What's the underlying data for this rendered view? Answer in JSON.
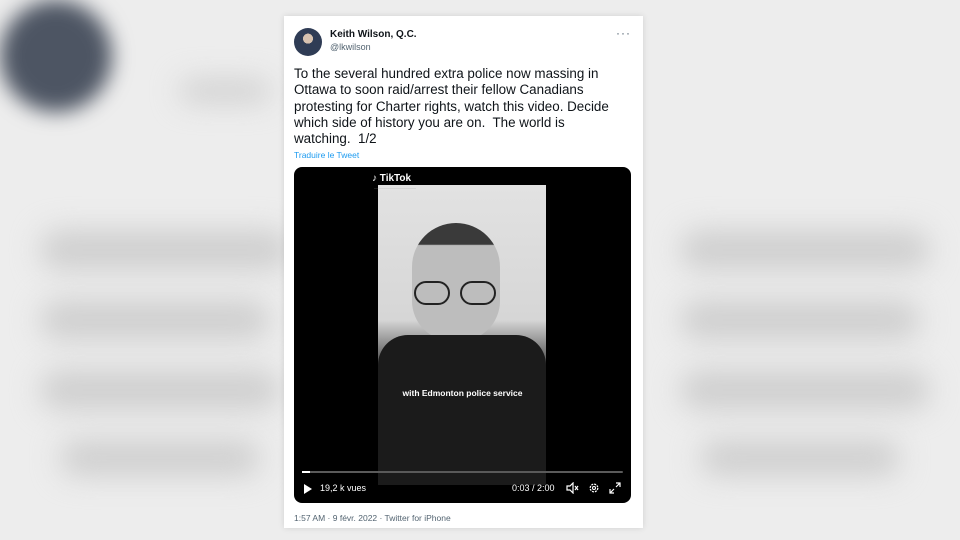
{
  "tweet": {
    "author_name": "Keith Wilson, Q.C.",
    "author_handle": "@lkwilson",
    "more_label": "···",
    "text": "To the several hundred extra police now massing in Ottawa to soon raid/arrest their fellow Canadians protesting for Charter rights, watch this video. Decide which side of history you are on.  The world is watching.  1/2",
    "translate_label": "Traduire le Tweet",
    "meta": "1:57 AM · 9 févr. 2022 · Twitter for iPhone"
  },
  "video": {
    "tiktok_label": "TikTok",
    "caption": "with Edmonton police service",
    "views": "19,2 k vues",
    "time": "0:03 / 2:00",
    "progress": 0.025
  },
  "colors": {
    "link": "#1d9bf0",
    "text": "#0f1419",
    "secondary": "#536471"
  }
}
